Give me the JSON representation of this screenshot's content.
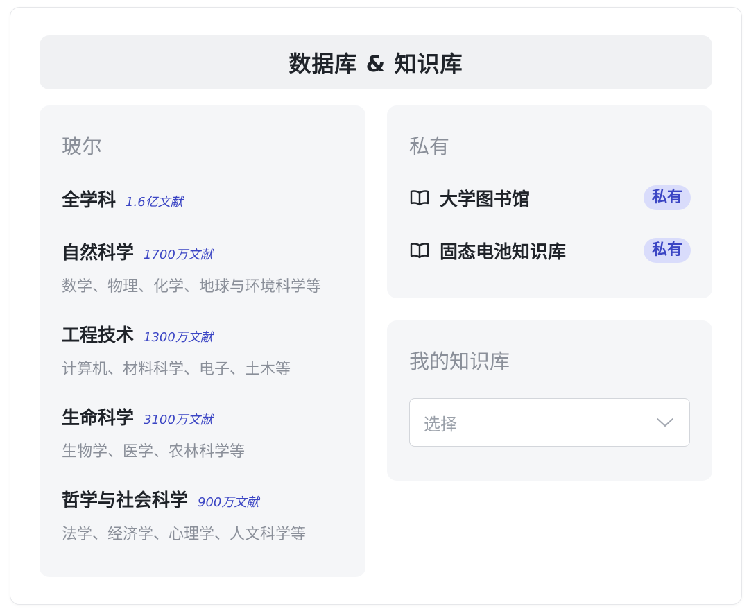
{
  "header": {
    "title": "数据库 & 知识库"
  },
  "bohr": {
    "title": "玻尔",
    "subjects": [
      {
        "name": "全学科",
        "count": "1.6亿文献",
        "desc": ""
      },
      {
        "name": "自然科学",
        "count": "1700万文献",
        "desc": "数学、物理、化学、地球与环境科学等"
      },
      {
        "name": "工程技术",
        "count": "1300万文献",
        "desc": "计算机、材料科学、电子、土木等"
      },
      {
        "name": "生命科学",
        "count": "3100万文献",
        "desc": "生物学、医学、农林科学等"
      },
      {
        "name": "哲学与社会科学",
        "count": "900万文献",
        "desc": "法学、经济学、心理学、人文科学等"
      }
    ]
  },
  "private": {
    "title": "私有",
    "items": [
      {
        "icon": "book-open-icon",
        "name": "大学图书馆",
        "badge": "私有"
      },
      {
        "icon": "book-open-icon",
        "name": "固态电池知识库",
        "badge": "私有"
      }
    ]
  },
  "mine": {
    "title": "我的知识库",
    "select": {
      "placeholder": "选择",
      "icon": "chevron-down-icon"
    }
  },
  "colors": {
    "accent": "#3b45c4",
    "badge_bg": "#d9dcfb",
    "panel_bg": "#f5f6f8",
    "header_bg": "#f0f1f3"
  }
}
